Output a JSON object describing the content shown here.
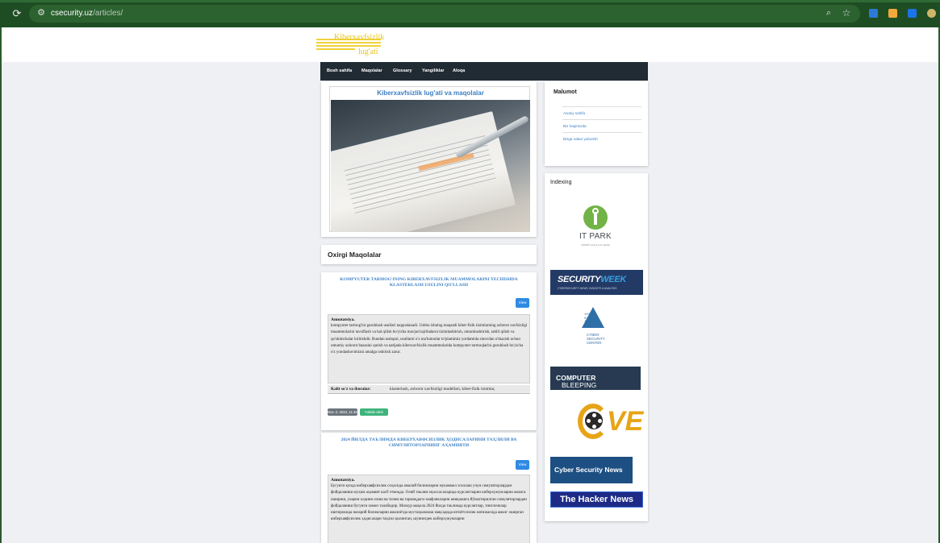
{
  "browser": {
    "url_host": "csecurity.uz",
    "url_path": "/articles/",
    "extension_colors": [
      "#2d79d6",
      "#f2a93b",
      "#1a73e8",
      "#cdb66a"
    ]
  },
  "site": {
    "logo_line1": "Kiberxavfsizlik",
    "logo_line2": "lug'ati",
    "nav": [
      "Bosh sahifa",
      "Maqolalar",
      "Glossary",
      "Yangiliklar",
      "Aloqa"
    ],
    "hero_title": "Kiberxavfsizlik lug'ati va maqolalar",
    "latest_heading": "Oxirgi Maqolalar"
  },
  "articles": [
    {
      "title": "KOMPYUTER TARMOG'INING KIBERXAVFSIZLIK MUAMMOLARINI YECHISHDA KLASTERLASH USULINI QO'LLASH",
      "view_label": "View",
      "abstract_heading": "Annotatsiya.",
      "abstract": "kompyuter tarmog'ini guruhlash usullari taqqoslanadi. Ushbu ishning maqsadi kiber-fizik tizimlarning axborot xavfsizligi muammolarini tavsiflash va hal qilish bo'yicha mavjud tajribalarni tizimlashtirish, umumlashtirish, tahlil qilish va qo'shimchalar kiritishdir. Bundan tashqari, usullarni o'z ma'lumotlar to'plamimiz yordamida sinovdan o'tkazish uchun umumiy axborot bazasini qurish va natijada kiberxavfsizlik muammolarida kompyuter tarmoqlarini guruhlash bo'yicha o'z yondashuvimizni amalga oshirish zarur.",
      "keywords_label": "Kalit so'z va iboralar:",
      "keywords": "klasterlash, axborot xavfsizligi modellari, kiber-fizik tizimlar,",
      "date": "Nov. 2, 2024, 11:46 a.m.",
      "lang": "Yuklab olish"
    },
    {
      "title": "2024 ЙИЛДА ТАЪЛИМДА КИБЕРХАВФСИЗЛИК ҲОДИСАЛАРИНИ ТАҲЛИЛИ ВА СИМУЛЯТОРЛАРНИНГ АҲАМИЯТИ",
      "view_label": "View",
      "abstract_heading": "Annotatsiya.",
      "abstract": "Бугунги кунда киберхавфсизлик соҳасида амалий билимларни мукаммал эгаллаш учун симуляторлардан фойдаланиш муҳим аҳамият касб этмоқда. Олий таълим муассасаларида курсантларни киберхужумларни амалга ошириш, уларни олдини олиш ва тизим ва тармоқдаги заифликларни аниқлашга йўналтирилган симуляторлардан фойдаланиш бугунги замон талабидир. Мазкур мақола 2024 йилда таълимда курсантлар, тинглочилар иштирокида назарий билимларни амалиётда мустаҳкамлаш мақсадида ютиётсизлик натижасида амалг оширган киберхавфсизлик ҳодисалари таҳлил қилинган, шунингдек киберхужумларни"
    }
  ],
  "sidebar": {
    "info_heading": "Malumot",
    "links": [
      "Asosiy sahifa",
      "Biz haqimizda",
      "Bizga xabar yuborish"
    ],
    "indexing_heading": "Indexing",
    "logos": {
      "itpark": "IT PARK",
      "itpark_sub": "SMART local & tech global",
      "securityweek_a": "SECURITY",
      "securityweek_b": "WEEK",
      "securityweek_tag": "CYBERSECURITY NEWS, INSIGHTS & ANALYSIS",
      "csc_bits": "1010\n0101\n1010",
      "csc_text": "CYBER\nSECURITY\nCENTER",
      "bleeping_a": "BLEEPING",
      "bleeping_b": "COMPUTER",
      "cve": "VE",
      "csn": "Cyber Security News",
      "thn": "The Hacker News"
    }
  }
}
